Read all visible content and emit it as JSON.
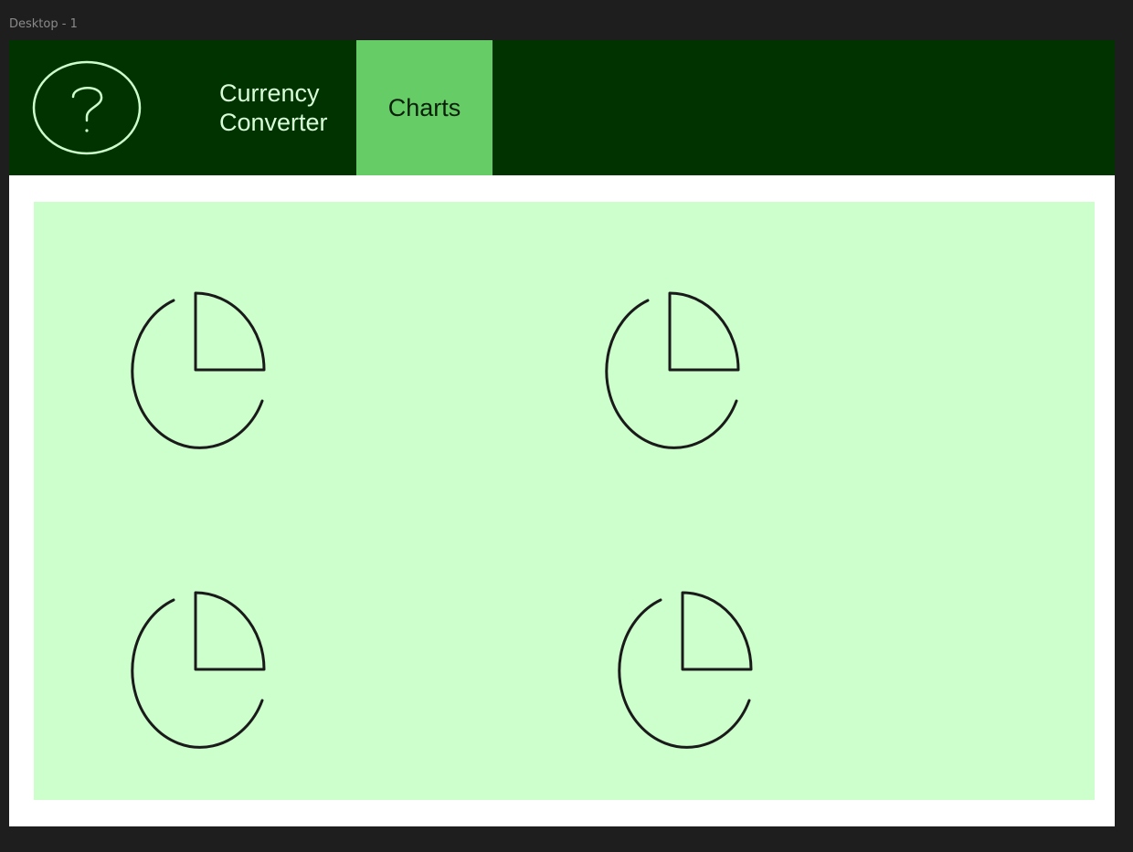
{
  "frame": {
    "label": "Desktop - 1"
  },
  "header": {
    "help_icon": "question-circle-icon",
    "nav": {
      "converter_label": "Currency Converter",
      "charts_label": "Charts",
      "active": "Charts"
    }
  },
  "charts": {
    "icon": "pie-chart-icon",
    "count": 4
  },
  "colors": {
    "header_bg": "#003300",
    "active_tab": "#66cc66",
    "content_bg": "#ccffcc",
    "icon_stroke": "#1a1a1a",
    "help_stroke": "#ccffcc"
  }
}
